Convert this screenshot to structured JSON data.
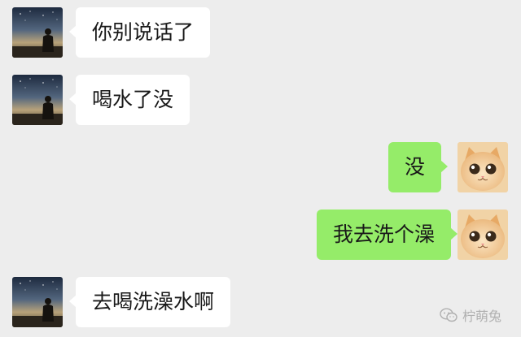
{
  "messages": [
    {
      "side": "left",
      "text": "你别说话了",
      "avatar": "night-silhouette-avatar"
    },
    {
      "side": "left",
      "text": "喝水了没",
      "avatar": "night-silhouette-avatar"
    },
    {
      "side": "right",
      "text": "没",
      "avatar": "cat-avatar"
    },
    {
      "side": "right",
      "text": "我去洗个澡",
      "avatar": "cat-avatar"
    },
    {
      "side": "left",
      "text": "去喝洗澡水啊",
      "avatar": "night-silhouette-avatar"
    }
  ],
  "watermark": {
    "text": "柠萌兔",
    "icon": "wechat-icon"
  },
  "colors": {
    "background": "#ededed",
    "incoming_bubble": "#ffffff",
    "outgoing_bubble": "#95ec69",
    "text": "#191919",
    "watermark": "#b0b0b0"
  }
}
